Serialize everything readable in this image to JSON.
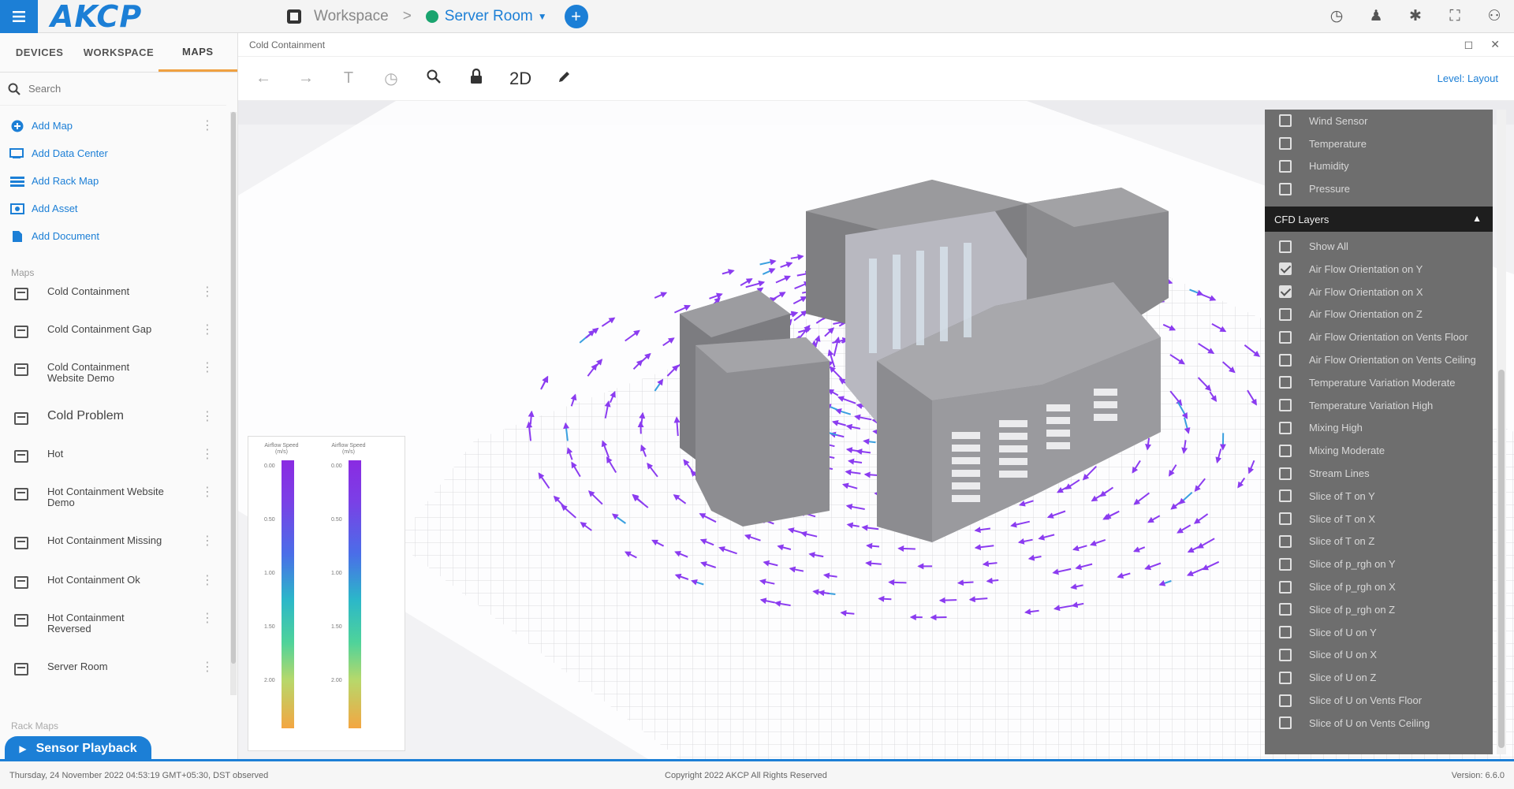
{
  "app": {
    "logo": "AKCP"
  },
  "breadcrumb": {
    "workspace": "Workspace",
    "separator": ">",
    "current": "Server Room",
    "add": "+"
  },
  "top_icons": [
    "clock-icon",
    "person-icon",
    "bug-icon",
    "fullscreen-icon",
    "user-account-icon"
  ],
  "sidebar": {
    "tabs": [
      {
        "label": "DEVICES",
        "active": false
      },
      {
        "label": "WORKSPACE",
        "active": false
      },
      {
        "label": "MAPS",
        "active": true
      }
    ],
    "search_placeholder": "Search",
    "actions": [
      {
        "label": "Add Map",
        "icon": "add-circle-icon"
      },
      {
        "label": "Add Data Center",
        "icon": "data-center-icon"
      },
      {
        "label": "Add Rack Map",
        "icon": "rack-map-icon"
      },
      {
        "label": "Add Asset",
        "icon": "asset-icon"
      },
      {
        "label": "Add Document",
        "icon": "document-icon"
      }
    ],
    "maps_label": "Maps",
    "maps": [
      "Cold Containment",
      "Cold Containment Gap",
      "Cold Containment Website Demo",
      "Cold Problem",
      "Hot",
      "Hot Containment Website Demo",
      "Hot Containment Missing",
      "Hot Containment Ok",
      "Hot Containment Reversed",
      "Server Room"
    ],
    "rack_maps_label": "Rack Maps",
    "playback_label": "Sensor Playback"
  },
  "panel": {
    "title": "Cold Containment",
    "toolbar_2d": "2D",
    "level_layout": "Level: Layout"
  },
  "legend": {
    "left_title": "Airflow Speed (m/s)",
    "right_title": "Airflow Speed (m/s)",
    "ticks": [
      "0.00",
      "0.50",
      "1.00",
      "1.50",
      "2.00"
    ]
  },
  "cfd": {
    "sensor_items": [
      {
        "label": "Wind Sensor",
        "checked": false
      },
      {
        "label": "Temperature",
        "checked": false
      },
      {
        "label": "Humidity",
        "checked": false
      },
      {
        "label": "Pressure",
        "checked": false
      }
    ],
    "header": "CFD Layers",
    "layers": [
      {
        "label": "Show All",
        "checked": false
      },
      {
        "label": "Air Flow Orientation on Y",
        "checked": true
      },
      {
        "label": "Air Flow Orientation on X",
        "checked": true
      },
      {
        "label": "Air Flow Orientation on Z",
        "checked": false
      },
      {
        "label": "Air Flow Orientation on Vents Floor",
        "checked": false
      },
      {
        "label": "Air Flow Orientation on Vents Ceiling",
        "checked": false
      },
      {
        "label": "Temperature Variation Moderate",
        "checked": false
      },
      {
        "label": "Temperature Variation High",
        "checked": false
      },
      {
        "label": "Mixing High",
        "checked": false
      },
      {
        "label": "Mixing Moderate",
        "checked": false
      },
      {
        "label": "Stream Lines",
        "checked": false
      },
      {
        "label": "Slice of T on Y",
        "checked": false
      },
      {
        "label": "Slice of T on X",
        "checked": false
      },
      {
        "label": "Slice of T on Z",
        "checked": false
      },
      {
        "label": "Slice of p_rgh on Y",
        "checked": false
      },
      {
        "label": "Slice of p_rgh on X",
        "checked": false
      },
      {
        "label": "Slice of p_rgh on Z",
        "checked": false
      },
      {
        "label": "Slice of U on Y",
        "checked": false
      },
      {
        "label": "Slice of U on X",
        "checked": false
      },
      {
        "label": "Slice of U on Z",
        "checked": false
      },
      {
        "label": "Slice of U on Vents Floor",
        "checked": false
      },
      {
        "label": "Slice of U on Vents Ceiling",
        "checked": false
      }
    ]
  },
  "footer": {
    "left": "Thursday, 24 November 2022 04:53:19 GMT+05:30, DST observed",
    "center": "Copyright 2022 AKCP All Rights Reserved",
    "right": "Version: 6.6.0"
  },
  "colors": {
    "accent": "#1c7fd6",
    "arrows": "#8b3cf0",
    "panel": "#6e6e6e"
  }
}
